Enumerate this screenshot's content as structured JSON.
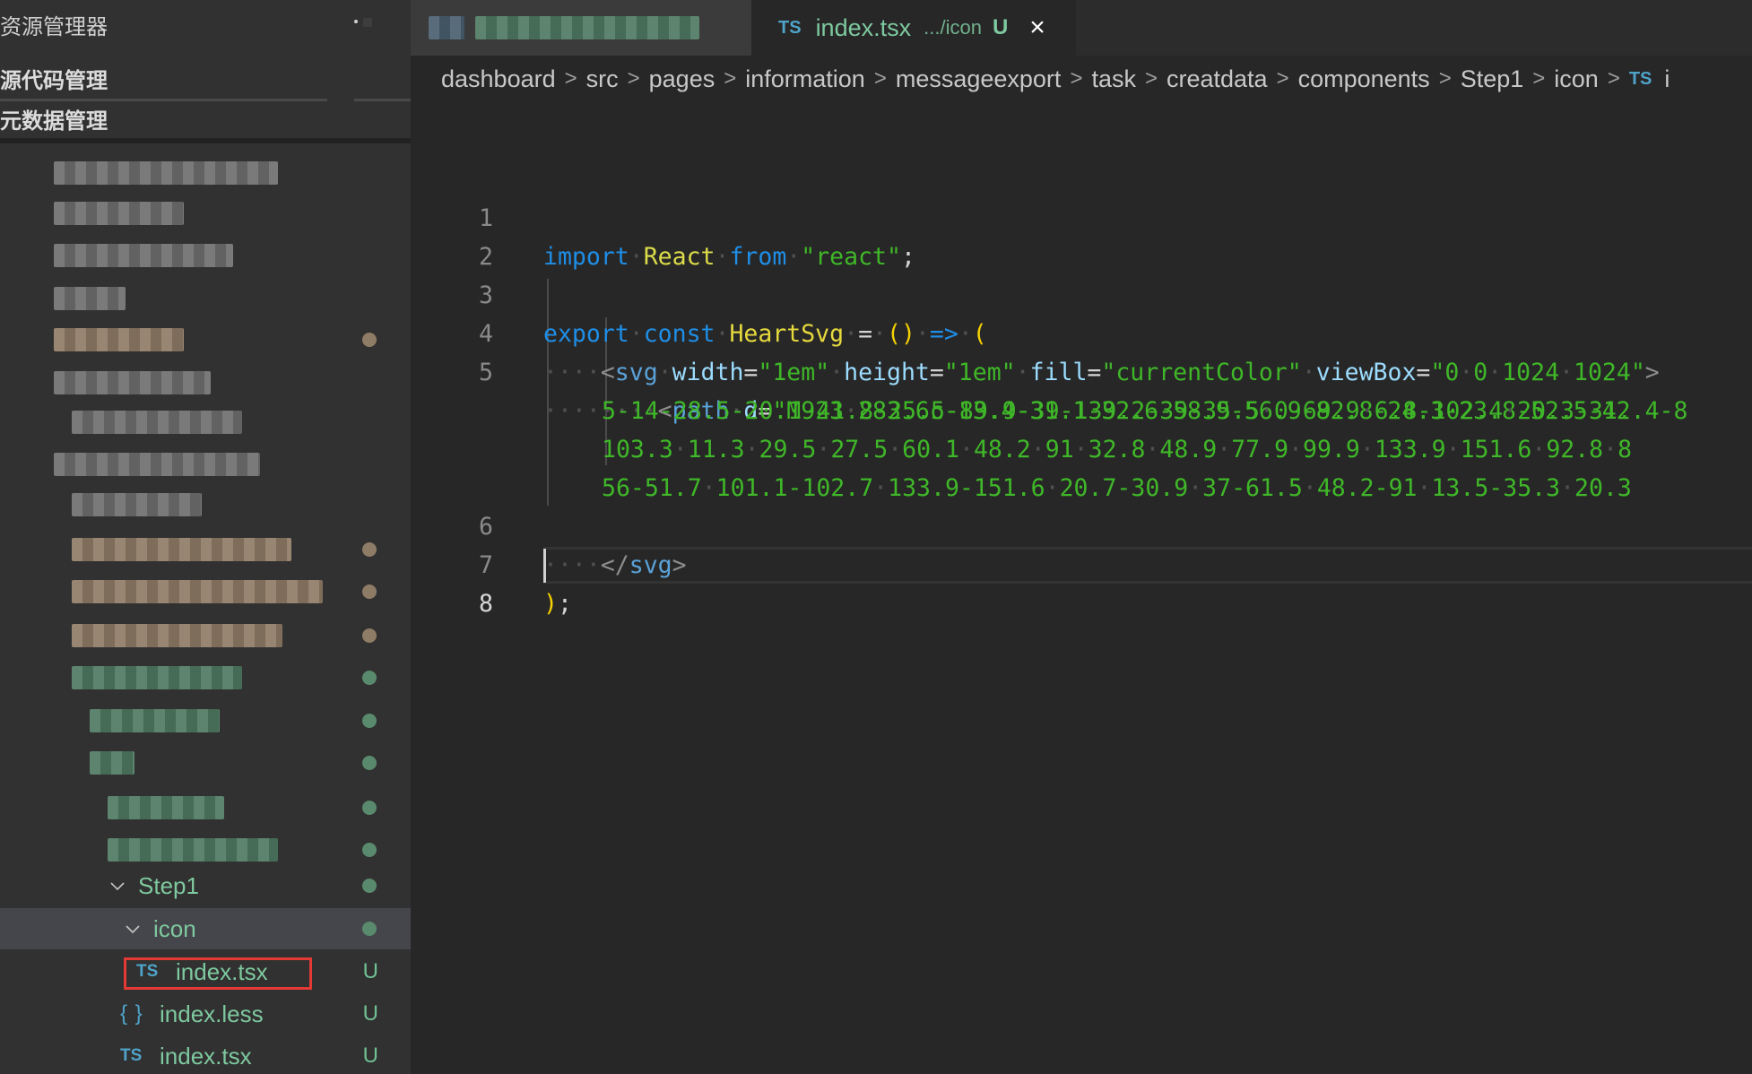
{
  "sidebar": {
    "title": "资源管理器",
    "section_1": "源代码管理",
    "section_2": "元数据管理",
    "obscured_rows": [
      {
        "indent": 1,
        "tone": "gray",
        "decoration": null
      },
      {
        "indent": 1,
        "tone": "gray",
        "decoration": null
      },
      {
        "indent": 1,
        "tone": "gray",
        "decoration": null
      },
      {
        "indent": 1,
        "tone": "gray",
        "decoration": null
      },
      {
        "indent": 1,
        "tone": "tan",
        "decoration": "dot-tan"
      },
      {
        "indent": 1,
        "tone": "gray",
        "decoration": null
      },
      {
        "indent": 2,
        "tone": "gray",
        "decoration": null
      },
      {
        "indent": 1,
        "tone": "gray",
        "decoration": null
      },
      {
        "indent": 2,
        "tone": "gray",
        "decoration": null
      },
      {
        "indent": 2,
        "tone": "tan",
        "decoration": "dot-tan"
      },
      {
        "indent": 2,
        "tone": "tan",
        "decoration": "dot-tan"
      },
      {
        "indent": 2,
        "tone": "tan",
        "decoration": "dot-tan"
      },
      {
        "indent": 2,
        "tone": "green",
        "decoration": "dot-green"
      },
      {
        "indent": 3,
        "tone": "green",
        "decoration": "dot-green"
      },
      {
        "indent": 3,
        "tone": "green",
        "decoration": "dot-green"
      },
      {
        "indent": 4,
        "tone": "green",
        "decoration": "dot-green"
      },
      {
        "indent": 4,
        "tone": "green",
        "decoration": "dot-green"
      }
    ],
    "tree": [
      {
        "label": "Step1",
        "type": "folder",
        "expanded": true,
        "decoration": "dot-green"
      },
      {
        "label": "icon",
        "type": "folder",
        "expanded": true,
        "selected": true,
        "decoration": "dot-green"
      },
      {
        "label": "index.tsx",
        "type": "ts",
        "icon": "TS",
        "status": "U",
        "highlighted": true
      },
      {
        "label": "index.less",
        "type": "less",
        "icon": "{ }",
        "status": "U"
      },
      {
        "label": "index.tsx",
        "type": "ts",
        "icon": "TS",
        "status": "U"
      }
    ]
  },
  "tabs": {
    "inactive_tab": {
      "label": "obscured",
      "blurred": true
    },
    "active_tab": {
      "icon": "TS",
      "name": "index.tsx",
      "description": ".../icon",
      "status": "U",
      "close_icon": "×"
    }
  },
  "breadcrumb": {
    "items": [
      "dashboard",
      "src",
      "pages",
      "information",
      "messageexport",
      "task",
      "creatdata",
      "components",
      "Step1",
      "icon"
    ],
    "file_icon": "TS",
    "file_partial": "i"
  },
  "editor": {
    "active_line": 8,
    "lines": [
      {
        "n": "1",
        "text": "import React from \"react\";"
      },
      {
        "n": "2",
        "text": ""
      },
      {
        "n": "3",
        "text": "export const HeartSvg = () => ("
      },
      {
        "n": "4",
        "text": "    <svg width=\"1em\" height=\"1em\" fill=\"currentColor\" viewBox=\"0 0 1024 1024\">"
      },
      {
        "n": "5",
        "text": "        <path d=\"M923 283.6c-13.4-31.1-32.6-58.9-56.9-82.8-24.3-23.8-52.5-42.4-8"
      },
      {
        "n": "",
        "text": "5-14-28.5-20.1-41.8-25.5-89.9-39-139.2-39-35.5 0-69.9 6.8-102.4 20.3-31."
      },
      {
        "n": "",
        "text": "103.3 11.3 29.5 27.5 60.1 48.2 91 32.8 48.9 77.9 99.9 133.9 151.6 92.8 8"
      },
      {
        "n": "",
        "text": "56-51.7 101.1-102.7 133.9-151.6 20.7-30.9 37-61.5 48.2-91 13.5-35.3 20.3"
      },
      {
        "n": "6",
        "text": "    </svg>"
      },
      {
        "n": "7",
        "text": ");"
      },
      {
        "n": "8",
        "text": ""
      }
    ],
    "tokens": {
      "l1": {
        "import": "import",
        "React": "React",
        "from": "from",
        "module": "\"react\"",
        "semi": ";"
      },
      "l3": {
        "export": "export",
        "const": "const",
        "name": "HeartSvg",
        "eq": "=",
        "parens": "()",
        "arrow": "=>",
        "open": "("
      },
      "l4": {
        "svg": "svg",
        "width_attr": "width",
        "width_val": "\"1em\"",
        "height_attr": "height",
        "height_val": "\"1em\"",
        "fill_attr": "fill",
        "fill_val": "\"currentColor\"",
        "viewbox_attr": "viewBox",
        "viewbox_val": "\"0 0 1024 1024\""
      },
      "l5": {
        "path": "path",
        "d_attr": "d",
        "d_val_start": "\"M923 283.6c-13.4-31.1-32.6-58.9-56.9-82.8-24.3-23.8-52.5-42.4-8"
      },
      "l5b": "5-14-28.5-20.1-41.8-25.5-89.9-39-139.2-39-35.5 0-69.9 6.8-102.4 20.3-31.",
      "l5c": "103.3 11.3 29.5 27.5 60.1 48.2 91 32.8 48.9 77.9 99.9 133.9 151.6 92.8 8",
      "l5d": "56-51.7 101.1-102.7 133.9-151.6 20.7-30.9 37-61.5 48.2-91 13.5-35.3 20.3",
      "l6": {
        "close": "svg"
      },
      "l7": {
        "paren": ")",
        "semi": ";"
      }
    }
  },
  "colors": {
    "keyword": "#1f8ee6",
    "identifier": "#dcdc4a",
    "string": "#3fb728",
    "tag": "#5aa2d8",
    "attribute": "#9cdcfe",
    "git_untracked": "#7ec99f",
    "git_modified": "#8f7c66",
    "highlight_box": "#e53935"
  }
}
